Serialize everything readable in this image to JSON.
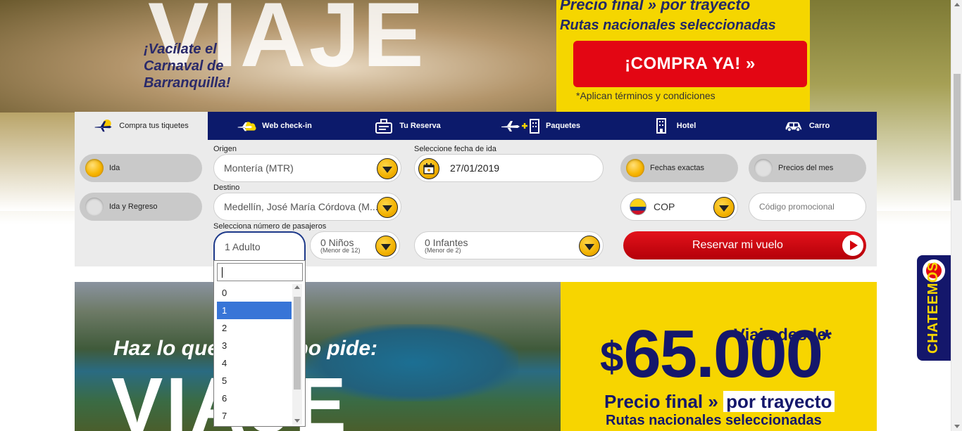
{
  "hero": {
    "headline": "VIAJE",
    "carnival_line1": "¡Vacílate el",
    "carnival_line2": "Carnaval de",
    "carnival_line3": "Barranquilla!",
    "promo_line1": "Precio final » por trayecto",
    "promo_line2": "Rutas nacionales seleccionadas",
    "buy_button": "¡COMPRA YA!  »",
    "conditions": "*Aplican términos y condiciones"
  },
  "tabs": [
    {
      "label": "Compra tus tiquetes",
      "icon": "plane-cloud-icon",
      "active": true
    },
    {
      "label": "Web check-in",
      "icon": "plane-cloud-icon",
      "active": false
    },
    {
      "label": "Tu Reserva",
      "icon": "ticket-icon",
      "active": false
    },
    {
      "label": "Paquetes",
      "icon": "plane-plus-hotel-icon",
      "active": false
    },
    {
      "label": "Hotel",
      "icon": "building-icon",
      "active": false
    },
    {
      "label": "Carro",
      "icon": "car-icon",
      "active": false
    }
  ],
  "trip_type": {
    "one_way": "Ida",
    "round_trip": "Ida y Regreso",
    "selected": "Ida"
  },
  "origin": {
    "label": "Origen",
    "value": "Montería (MTR)"
  },
  "destination": {
    "label": "Destino",
    "value": "Medellín, José María Córdova (M..."
  },
  "departure": {
    "label": "Seleccione fecha de ida",
    "value": "27/01/2019"
  },
  "date_mode": {
    "exact": "Fechas exactas",
    "month": "Precios del mes",
    "selected": "Fechas exactas"
  },
  "currency": {
    "value": "COP"
  },
  "promo_code": {
    "placeholder": "Código promocional"
  },
  "passengers": {
    "label": "Selecciona número de pasajeros",
    "adults": "1 Adulto",
    "children": "0 Niños",
    "children_note": "(Menor de 12)",
    "infants": "0 Infantes",
    "infants_note": "(Menor de 2)"
  },
  "adult_dropdown": {
    "search_value": "",
    "options": [
      "0",
      "1",
      "2",
      "3",
      "4",
      "5",
      "6",
      "7"
    ],
    "selected": "1"
  },
  "reserve_button": "Reservar mi vuelo",
  "banner": {
    "tagline": "Haz lo que tu cuerpo pide:",
    "headline": "VIAJE",
    "travel_from": "Viaja desde",
    "currency_symbol": "$",
    "price": "65.000",
    "asterisk": "*",
    "final_price": "Precio final » ",
    "per_leg": "por trayecto",
    "routes": "Rutas nacionales seleccionadas"
  },
  "chat": {
    "label": "CHATEEMOS"
  },
  "colors": {
    "navy": "#0c1a6b",
    "red": "#e30613",
    "yellow": "#f7d500",
    "selected": "#3875d7"
  }
}
